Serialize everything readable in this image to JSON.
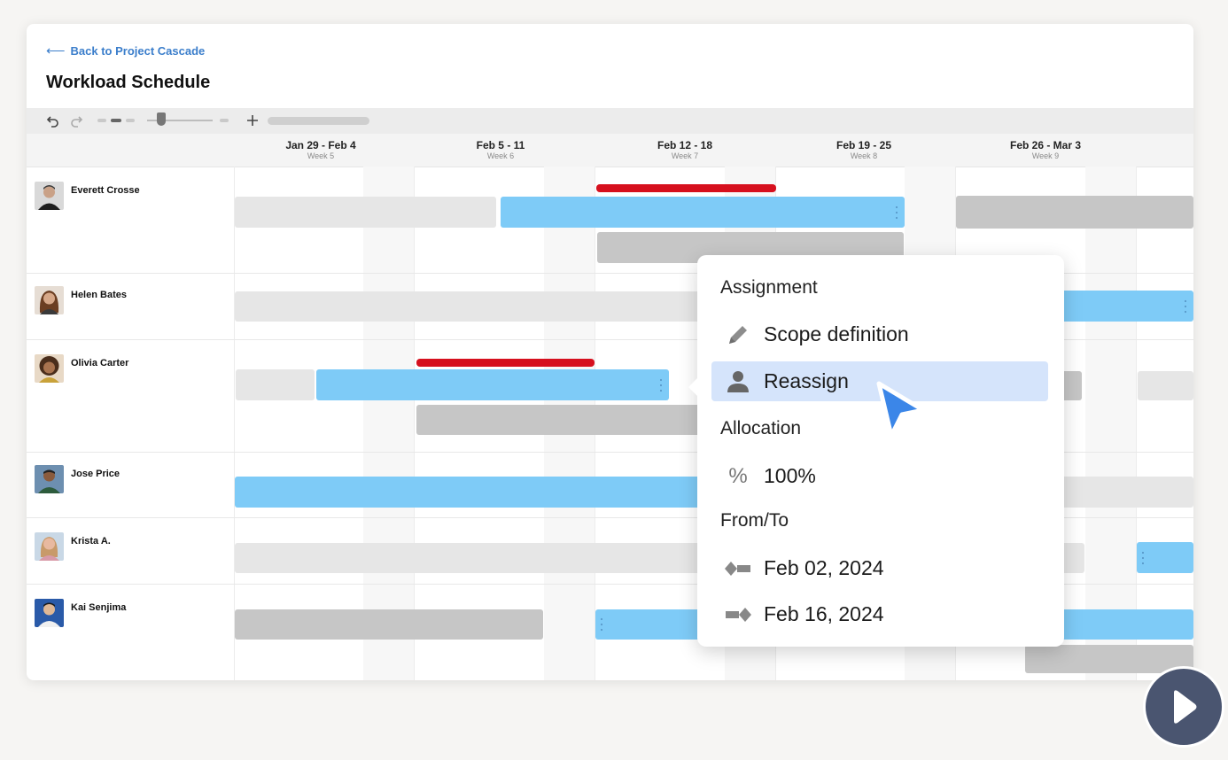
{
  "header": {
    "back_link": "Back to Project Cascade",
    "title": "Workload Schedule"
  },
  "weeks": [
    {
      "range": "Jan 29 - Feb 4",
      "week": "Week 5"
    },
    {
      "range": "Feb 5 - 11",
      "week": "Week 6"
    },
    {
      "range": "Feb 12 - 18",
      "week": "Week 7"
    },
    {
      "range": "Feb 19 - 25",
      "week": "Week 8"
    },
    {
      "range": "Feb 26 - Mar 3",
      "week": "Week 9"
    }
  ],
  "people": [
    {
      "name": "Everett Crosse"
    },
    {
      "name": "Helen Bates"
    },
    {
      "name": "Olivia Carter"
    },
    {
      "name": "Jose Price"
    },
    {
      "name": "Krista A."
    },
    {
      "name": "Kai Senjima"
    }
  ],
  "popover": {
    "assignment_heading": "Assignment",
    "scope_label": "Scope definition",
    "reassign_label": "Reassign",
    "allocation_heading": "Allocation",
    "allocation_value": "100%",
    "from_to_heading": "From/To",
    "from_date": "Feb 02, 2024",
    "to_date": "Feb 16, 2024"
  },
  "colors": {
    "accent_link": "#3b7ecb",
    "assignment_bar": "#7ecbf7",
    "overallocation": "#d6101e",
    "highlight": "#d5e4fb",
    "cursor": "#3b86e8"
  }
}
